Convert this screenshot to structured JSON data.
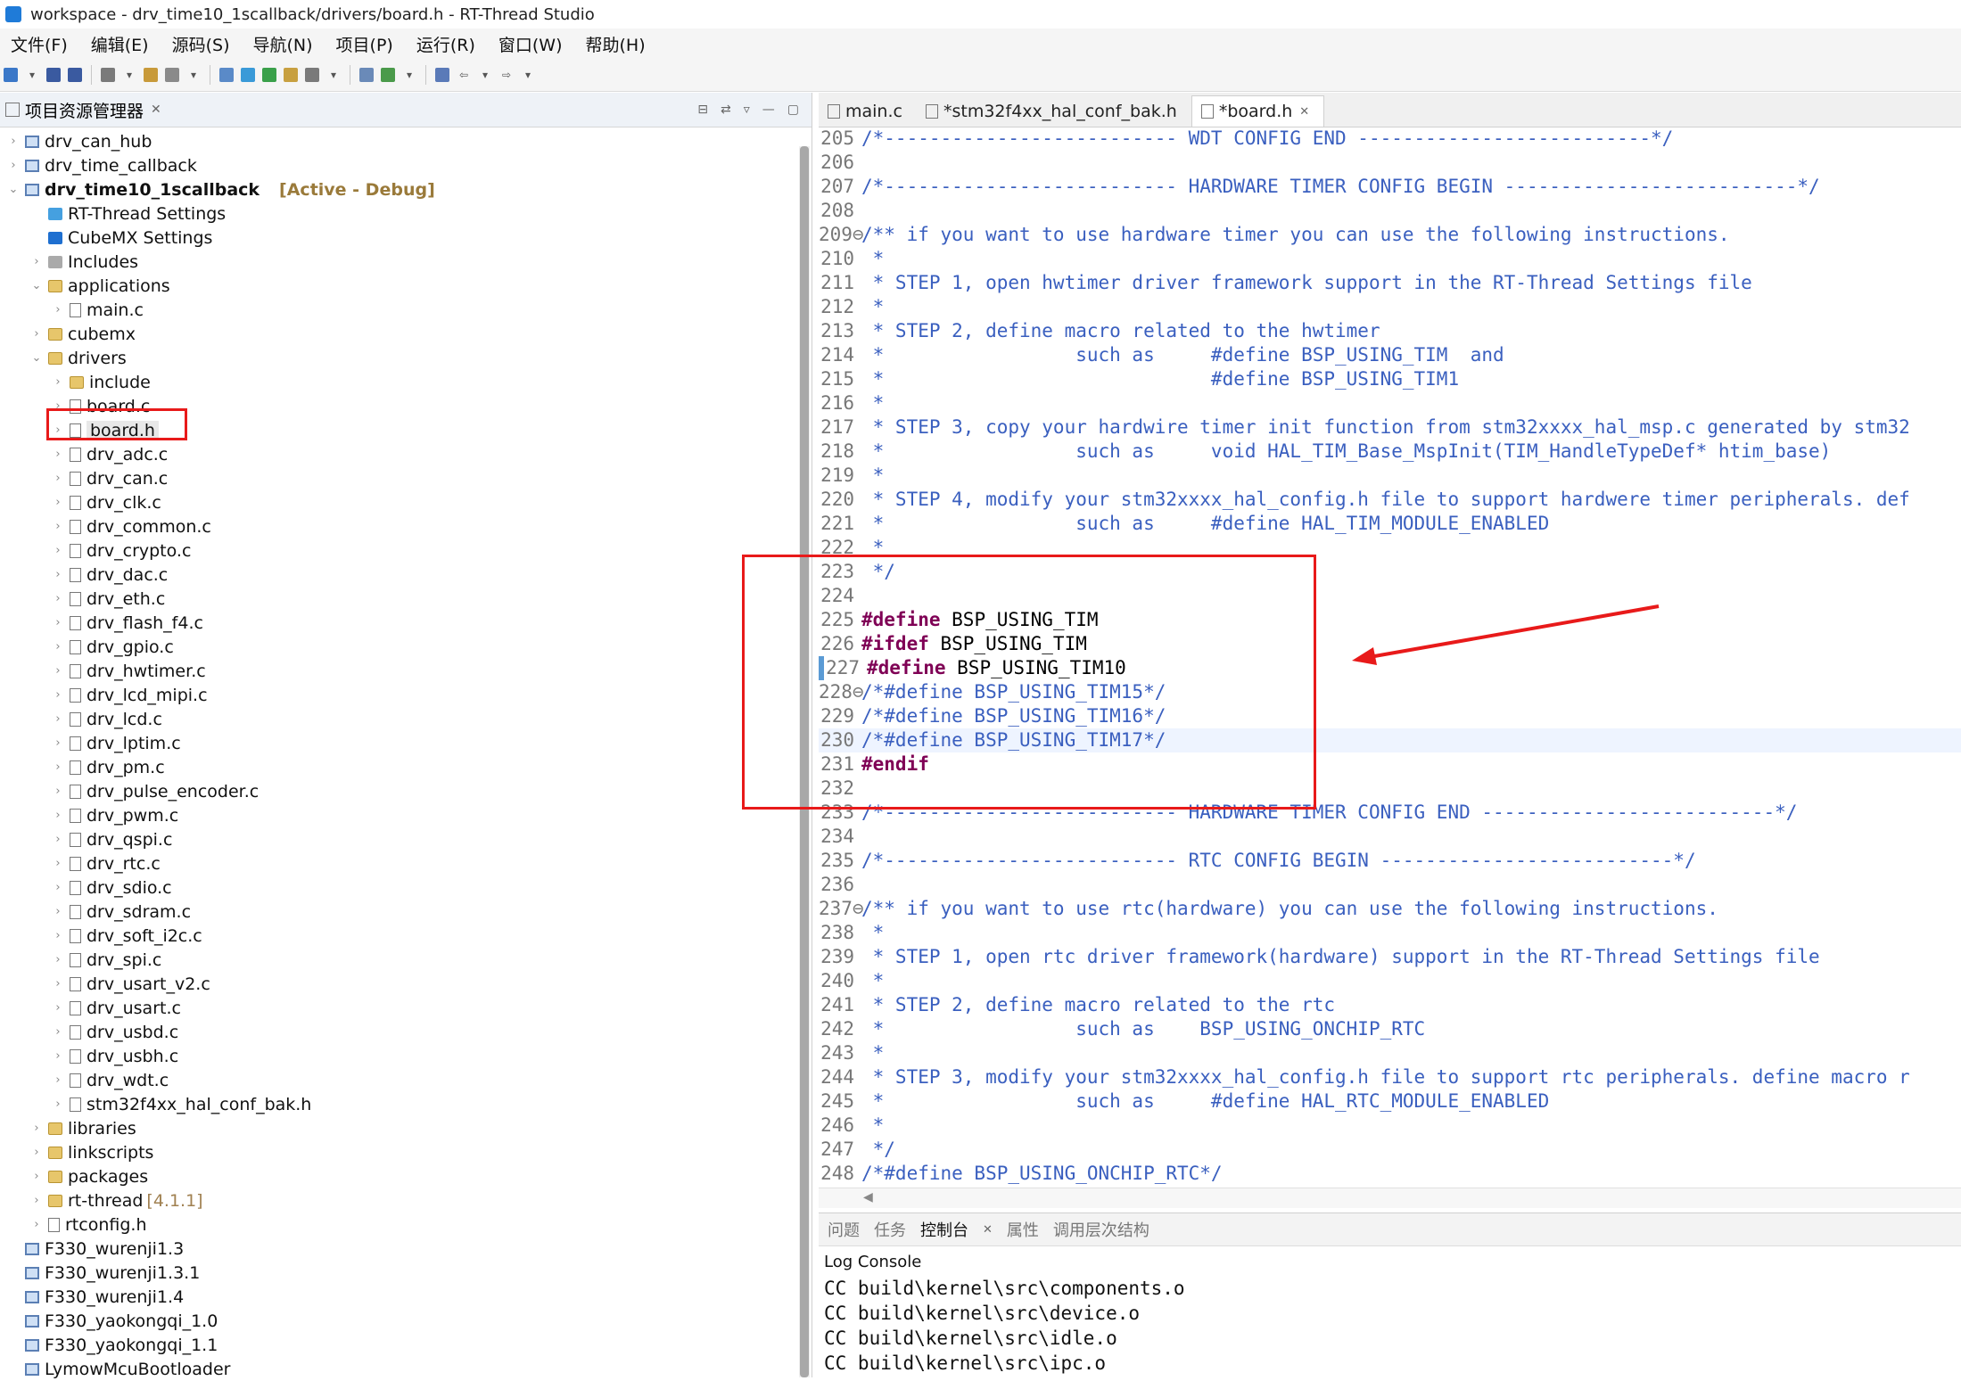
{
  "window": {
    "title": "workspace - drv_time10_1scallback/drivers/board.h - RT-Thread Studio"
  },
  "menu": [
    "文件(F)",
    "编辑(E)",
    "源码(S)",
    "导航(N)",
    "项目(P)",
    "运行(R)",
    "窗口(W)",
    "帮助(H)"
  ],
  "explorer": {
    "title": "项目资源管理器",
    "items": [
      {
        "label": "drv_can_hub",
        "level": 0,
        "arrow": "›",
        "icon": "proj"
      },
      {
        "label": "drv_time_callback",
        "level": 0,
        "arrow": "›",
        "icon": "proj"
      },
      {
        "label": "drv_time10_1scallback",
        "level": 0,
        "arrow": "⌄",
        "icon": "proj",
        "bold": true,
        "tag": "[Active - Debug]"
      },
      {
        "label": "RT-Thread Settings",
        "level": 1,
        "arrow": "",
        "icon": "rt"
      },
      {
        "label": "CubeMX Settings",
        "level": 1,
        "arrow": "",
        "icon": "mx"
      },
      {
        "label": "Includes",
        "level": 1,
        "arrow": "›",
        "icon": "inc"
      },
      {
        "label": "applications",
        "level": 1,
        "arrow": "⌄",
        "icon": "folder"
      },
      {
        "label": "main.c",
        "level": 2,
        "arrow": "›",
        "icon": "file"
      },
      {
        "label": "cubemx",
        "level": 1,
        "arrow": "›",
        "icon": "folder"
      },
      {
        "label": "drivers",
        "level": 1,
        "arrow": "⌄",
        "icon": "folder"
      },
      {
        "label": "include",
        "level": 2,
        "arrow": "›",
        "icon": "folder"
      },
      {
        "label": "board.c",
        "level": 2,
        "arrow": "›",
        "icon": "file"
      },
      {
        "label": "board.h",
        "level": 2,
        "arrow": "›",
        "icon": "file",
        "selected": true
      },
      {
        "label": "drv_adc.c",
        "level": 2,
        "arrow": "›",
        "icon": "file"
      },
      {
        "label": "drv_can.c",
        "level": 2,
        "arrow": "›",
        "icon": "file"
      },
      {
        "label": "drv_clk.c",
        "level": 2,
        "arrow": "›",
        "icon": "file"
      },
      {
        "label": "drv_common.c",
        "level": 2,
        "arrow": "›",
        "icon": "file"
      },
      {
        "label": "drv_crypto.c",
        "level": 2,
        "arrow": "›",
        "icon": "file"
      },
      {
        "label": "drv_dac.c",
        "level": 2,
        "arrow": "›",
        "icon": "file"
      },
      {
        "label": "drv_eth.c",
        "level": 2,
        "arrow": "›",
        "icon": "file"
      },
      {
        "label": "drv_flash_f4.c",
        "level": 2,
        "arrow": "›",
        "icon": "file"
      },
      {
        "label": "drv_gpio.c",
        "level": 2,
        "arrow": "›",
        "icon": "file"
      },
      {
        "label": "drv_hwtimer.c",
        "level": 2,
        "arrow": "›",
        "icon": "file"
      },
      {
        "label": "drv_lcd_mipi.c",
        "level": 2,
        "arrow": "›",
        "icon": "file"
      },
      {
        "label": "drv_lcd.c",
        "level": 2,
        "arrow": "›",
        "icon": "file"
      },
      {
        "label": "drv_lptim.c",
        "level": 2,
        "arrow": "›",
        "icon": "file"
      },
      {
        "label": "drv_pm.c",
        "level": 2,
        "arrow": "›",
        "icon": "file"
      },
      {
        "label": "drv_pulse_encoder.c",
        "level": 2,
        "arrow": "›",
        "icon": "file"
      },
      {
        "label": "drv_pwm.c",
        "level": 2,
        "arrow": "›",
        "icon": "file"
      },
      {
        "label": "drv_qspi.c",
        "level": 2,
        "arrow": "›",
        "icon": "file"
      },
      {
        "label": "drv_rtc.c",
        "level": 2,
        "arrow": "›",
        "icon": "file"
      },
      {
        "label": "drv_sdio.c",
        "level": 2,
        "arrow": "›",
        "icon": "file"
      },
      {
        "label": "drv_sdram.c",
        "level": 2,
        "arrow": "›",
        "icon": "file"
      },
      {
        "label": "drv_soft_i2c.c",
        "level": 2,
        "arrow": "›",
        "icon": "file"
      },
      {
        "label": "drv_spi.c",
        "level": 2,
        "arrow": "›",
        "icon": "file"
      },
      {
        "label": "drv_usart_v2.c",
        "level": 2,
        "arrow": "›",
        "icon": "file"
      },
      {
        "label": "drv_usart.c",
        "level": 2,
        "arrow": "›",
        "icon": "file"
      },
      {
        "label": "drv_usbd.c",
        "level": 2,
        "arrow": "›",
        "icon": "file"
      },
      {
        "label": "drv_usbh.c",
        "level": 2,
        "arrow": "›",
        "icon": "file"
      },
      {
        "label": "drv_wdt.c",
        "level": 2,
        "arrow": "›",
        "icon": "file"
      },
      {
        "label": "stm32f4xx_hal_conf_bak.h",
        "level": 2,
        "arrow": "›",
        "icon": "file"
      },
      {
        "label": "libraries",
        "level": 1,
        "arrow": "›",
        "icon": "folder"
      },
      {
        "label": "linkscripts",
        "level": 1,
        "arrow": "›",
        "icon": "folder"
      },
      {
        "label": "packages",
        "level": 1,
        "arrow": "›",
        "icon": "folder"
      },
      {
        "label": "rt-thread",
        "level": 1,
        "arrow": "›",
        "icon": "folder",
        "ver": "[4.1.1]"
      },
      {
        "label": "rtconfig.h",
        "level": 1,
        "arrow": "›",
        "icon": "file"
      },
      {
        "label": "F330_wurenji1.3",
        "level": 0,
        "arrow": "",
        "icon": "proj"
      },
      {
        "label": "F330_wurenji1.3.1",
        "level": 0,
        "arrow": "",
        "icon": "proj"
      },
      {
        "label": "F330_wurenji1.4",
        "level": 0,
        "arrow": "",
        "icon": "proj"
      },
      {
        "label": "F330_yaokongqi_1.0",
        "level": 0,
        "arrow": "",
        "icon": "proj"
      },
      {
        "label": "F330_yaokongqi_1.1",
        "level": 0,
        "arrow": "",
        "icon": "proj"
      },
      {
        "label": "LymowMcuBootloader",
        "level": 0,
        "arrow": "",
        "icon": "proj"
      }
    ]
  },
  "editor": {
    "tabs": [
      {
        "label": "main.c",
        "active": false
      },
      {
        "label": "*stm32f4xx_hal_conf_bak.h",
        "active": false
      },
      {
        "label": "*board.h",
        "active": true
      }
    ],
    "lines": [
      {
        "n": "205",
        "t": "/*-------------------------- WDT CONFIG END --------------------------*/",
        "c": "cm2"
      },
      {
        "n": "206",
        "t": "",
        "c": ""
      },
      {
        "n": "207",
        "t": "/*-------------------------- HARDWARE TIMER CONFIG BEGIN --------------------------*/",
        "c": "cm2"
      },
      {
        "n": "208",
        "t": "",
        "c": ""
      },
      {
        "n": "209⊖",
        "t": "/** if you want to use hardware timer you can use the following instructions.",
        "c": "cm2"
      },
      {
        "n": "210",
        "t": " *",
        "c": "cm2"
      },
      {
        "n": "211",
        "t": " * STEP 1, open hwtimer driver framework support in the RT-Thread Settings file",
        "c": "cm2"
      },
      {
        "n": "212",
        "t": " *",
        "c": "cm2"
      },
      {
        "n": "213",
        "t": " * STEP 2, define macro related to the hwtimer",
        "c": "cm2"
      },
      {
        "n": "214",
        "t": " *                 such as     #define BSP_USING_TIM  and",
        "c": "cm2"
      },
      {
        "n": "215",
        "t": " *                             #define BSP_USING_TIM1",
        "c": "cm2"
      },
      {
        "n": "216",
        "t": " *",
        "c": "cm2"
      },
      {
        "n": "217",
        "t": " * STEP 3, copy your hardwire timer init function from stm32xxxx_hal_msp.c generated by stm32",
        "c": "cm2"
      },
      {
        "n": "218",
        "t": " *                 such as     void HAL_TIM_Base_MspInit(TIM_HandleTypeDef* htim_base)",
        "c": "cm2"
      },
      {
        "n": "219",
        "t": " *",
        "c": "cm2"
      },
      {
        "n": "220",
        "t": " * STEP 4, modify your stm32xxxx_hal_config.h file to support hardwere timer peripherals. def",
        "c": "cm2"
      },
      {
        "n": "221",
        "t": " *                 such as     #define HAL_TIM_MODULE_ENABLED",
        "c": "cm2"
      },
      {
        "n": "222",
        "t": " *",
        "c": "cm2"
      },
      {
        "n": "223",
        "t": " */",
        "c": "cm2"
      },
      {
        "n": "224",
        "t": "",
        "c": ""
      },
      {
        "n": "225",
        "t": "#define BSP_USING_TIM",
        "c": "kwline"
      },
      {
        "n": "226",
        "t": "#ifdef BSP_USING_TIM",
        "c": "kwline"
      },
      {
        "n": "227",
        "t": "#define BSP_USING_TIM10",
        "c": "kwline"
      },
      {
        "n": "228⊖",
        "t": "/*#define BSP_USING_TIM15*/",
        "c": "cm2"
      },
      {
        "n": "229",
        "t": "/*#define BSP_USING_TIM16*/",
        "c": "cm2"
      },
      {
        "n": "230",
        "t": "/*#define BSP_USING_TIM17*/",
        "c": "cm2"
      },
      {
        "n": "231",
        "t": "#endif",
        "c": "kwonly"
      },
      {
        "n": "232",
        "t": "",
        "c": ""
      },
      {
        "n": "233",
        "t": "/*-------------------------- HARDWARE TIMER CONFIG END --------------------------*/",
        "c": "cm2"
      },
      {
        "n": "234",
        "t": "",
        "c": ""
      },
      {
        "n": "235",
        "t": "/*-------------------------- RTC CONFIG BEGIN --------------------------*/",
        "c": "cm2"
      },
      {
        "n": "236",
        "t": "",
        "c": ""
      },
      {
        "n": "237⊖",
        "t": "/** if you want to use rtc(hardware) you can use the following instructions.",
        "c": "cm2"
      },
      {
        "n": "238",
        "t": " *",
        "c": "cm2"
      },
      {
        "n": "239",
        "t": " * STEP 1, open rtc driver framework(hardware) support in the RT-Thread Settings file",
        "c": "cm2"
      },
      {
        "n": "240",
        "t": " *",
        "c": "cm2"
      },
      {
        "n": "241",
        "t": " * STEP 2, define macro related to the rtc",
        "c": "cm2"
      },
      {
        "n": "242",
        "t": " *                 such as    BSP_USING_ONCHIP_RTC",
        "c": "cm2"
      },
      {
        "n": "243",
        "t": " *",
        "c": "cm2"
      },
      {
        "n": "244",
        "t": " * STEP 3, modify your stm32xxxx_hal_config.h file to support rtc peripherals. define macro r",
        "c": "cm2"
      },
      {
        "n": "245",
        "t": " *                 such as     #define HAL_RTC_MODULE_ENABLED",
        "c": "cm2"
      },
      {
        "n": "246",
        "t": " *",
        "c": "cm2"
      },
      {
        "n": "247",
        "t": " */",
        "c": "cm2"
      },
      {
        "n": "248",
        "t": "/*#define BSP_USING_ONCHIP_RTC*/",
        "c": "cm2"
      }
    ]
  },
  "console": {
    "tabs": [
      {
        "label": "问题",
        "active": false
      },
      {
        "label": "任务",
        "active": false
      },
      {
        "label": "控制台",
        "active": true
      },
      {
        "label": "属性",
        "active": false
      },
      {
        "label": "调用层次结构",
        "active": false
      }
    ],
    "title": "Log Console",
    "lines": [
      "CC build\\kernel\\src\\components.o",
      "CC build\\kernel\\src\\device.o",
      "CC build\\kernel\\src\\idle.o",
      "CC build\\kernel\\src\\ipc.o"
    ]
  },
  "colors": {
    "annotation": "#e81a1a",
    "comment": "#3a5fbf",
    "keyword": "#7f0055"
  }
}
